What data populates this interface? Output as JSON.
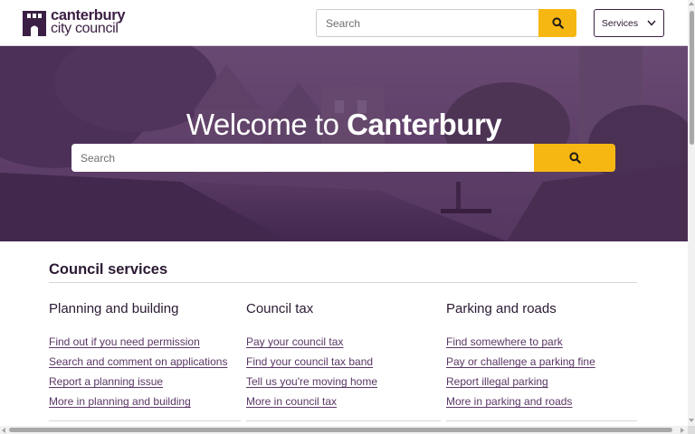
{
  "brand": {
    "line1": "canterbury",
    "line2": "city council",
    "color": "#3c1f44"
  },
  "header": {
    "search_placeholder": "Search",
    "search_icon": "search-icon",
    "services_label": "Services",
    "services_icon": "chevron-down-icon"
  },
  "hero": {
    "title_prefix": "Welcome to ",
    "title_emphasis": "Canterbury",
    "search_placeholder": "Search",
    "overlay_color": "#4a2a55"
  },
  "accent_color": "#f6b713",
  "council_services": {
    "title": "Council services",
    "columns": [
      {
        "heading": "Planning and building",
        "links": [
          "Find out if you need permission",
          "Search and comment on applications",
          "Report a planning issue",
          "More in planning and building"
        ]
      },
      {
        "heading": "Council tax",
        "links": [
          "Pay your council tax",
          "Find your council tax band",
          "Tell us you're moving home",
          "More in council tax"
        ]
      },
      {
        "heading": "Parking and roads",
        "links": [
          "Find somewhere to park",
          "Pay or challenge a parking fine",
          "Report illegal parking",
          "More in parking and roads"
        ]
      }
    ]
  }
}
